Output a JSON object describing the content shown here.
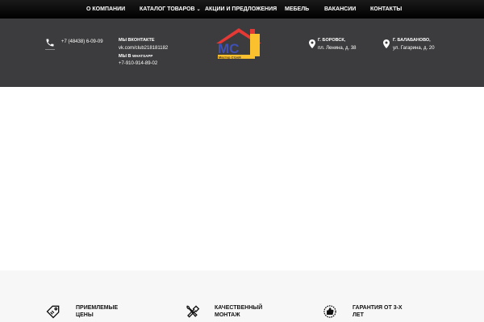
{
  "nav": {
    "items": [
      {
        "label": "О КОМПАНИИ"
      },
      {
        "label": "КАТАЛОГ ТОВАРОВ",
        "has_dropdown": true
      },
      {
        "label": "АКЦИИ И ПРЕДЛОЖЕНИЯ"
      },
      {
        "label": "МЕБЕЛЬ"
      },
      {
        "label": "ВАКАНСИИ"
      },
      {
        "label": "КОНТАКТЫ"
      }
    ]
  },
  "header": {
    "phone": "+7 (48438) 6-09-09",
    "vk_title": "МЫ ВКОНТАКТЕ",
    "vk_link": "vk.com/club218181182",
    "whatsapp_title": "МЫ В",
    "whatsapp_brand": "WHATSAPP",
    "whatsapp_phone": "+7-910-914-89-02",
    "logo_text": "МС",
    "logo_sub": "Мастер Строй",
    "address1_city": "Г. БОРОВСК,",
    "address1_street": "пл. Ленина, д. 38",
    "address2_city": "Г. БАЛАБАНОВО,",
    "address2_street": "ул. Гагарина, д. 20"
  },
  "features": [
    {
      "label": "ПРИЕМЛЕМЫЕ ЦЕНЫ",
      "icon": "price-tag-icon"
    },
    {
      "label": "КАЧЕСТВЕННЫЙ МОНТАЖ",
      "icon": "tools-icon"
    },
    {
      "label": "ГАРАНТИЯ ОТ 3-Х ЛЕТ",
      "icon": "thumbs-up-badge-icon"
    }
  ],
  "colors": {
    "nav_bg": "#000000",
    "header_bg": "#3c3c3e",
    "logo_roof": "#e53935",
    "logo_letters": "#3f51b5",
    "logo_accent": "#fbc02d"
  }
}
